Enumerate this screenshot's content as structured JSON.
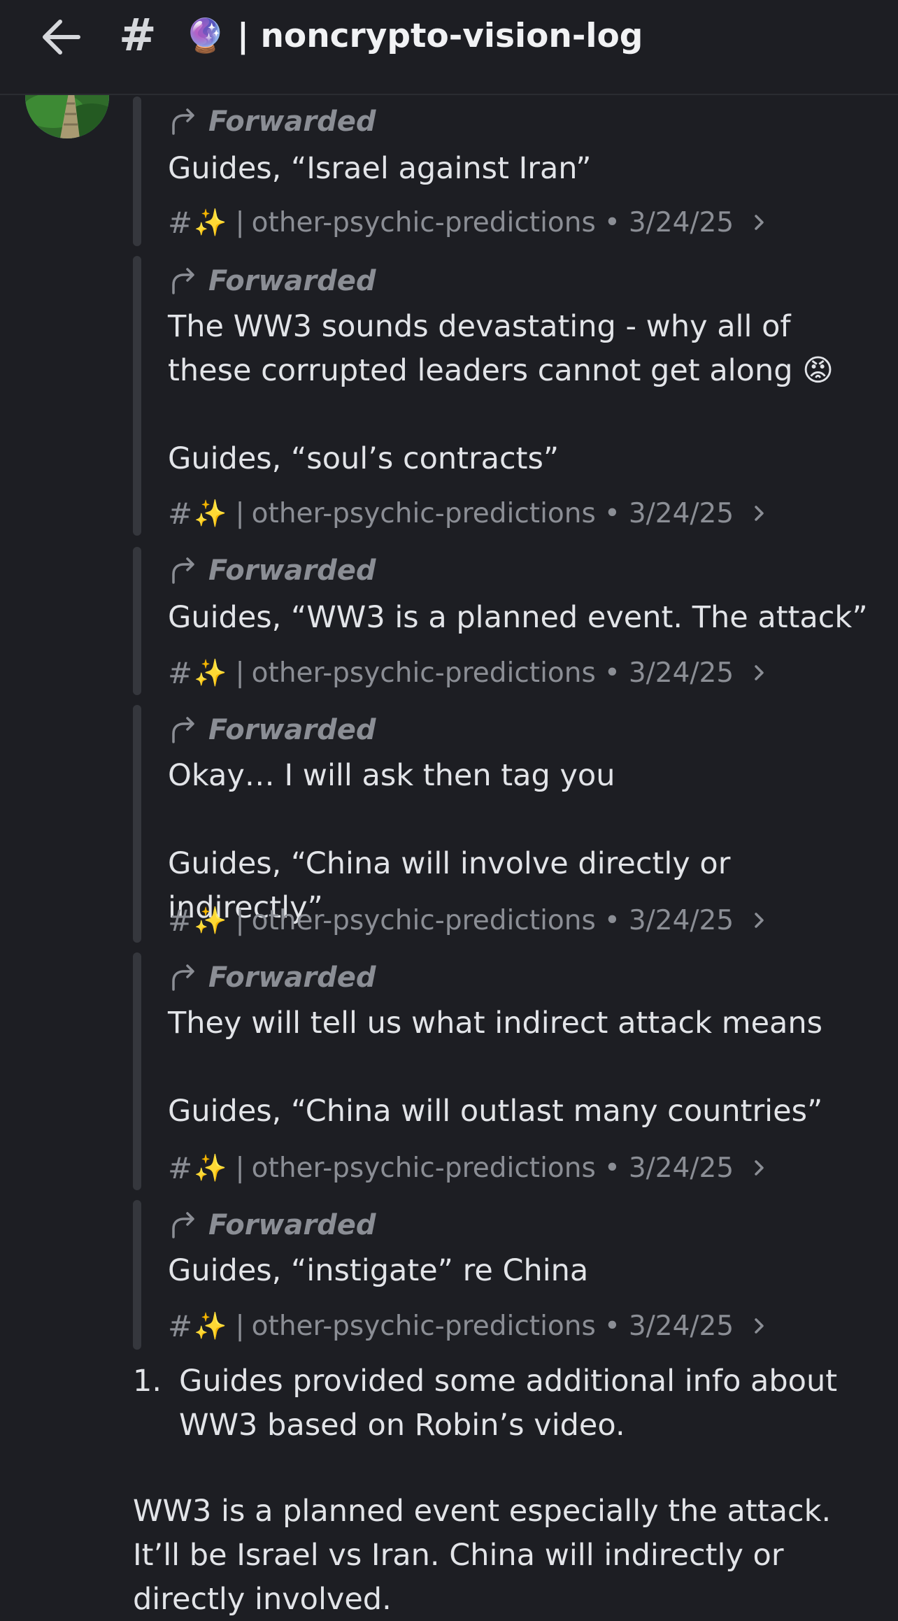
{
  "header": {
    "hash": "#",
    "title_emoji": "🔮",
    "title_sep": "|",
    "title_name": "noncrypto-vision-log"
  },
  "forwards": [
    {
      "label": "Forwarded",
      "text": "Guides, “Israel against Iran”",
      "source": {
        "hash": "#",
        "emoji": "✨",
        "sep": "|",
        "channel": "other-psychic-predictions",
        "dot": "•",
        "date": "3/24/25"
      }
    },
    {
      "label": "Forwarded",
      "text": "The WW3 sounds devastating - why all of these corrupted leaders cannot get along 😡\n\nGuides, “soul’s contracts”",
      "source": {
        "hash": "#",
        "emoji": "✨",
        "sep": "|",
        "channel": "other-psychic-predictions",
        "dot": "•",
        "date": "3/24/25"
      }
    },
    {
      "label": "Forwarded",
      "text": "Guides, “WW3 is a planned event. The attack”",
      "source": {
        "hash": "#",
        "emoji": "✨",
        "sep": "|",
        "channel": "other-psychic-predictions",
        "dot": "•",
        "date": "3/24/25"
      }
    },
    {
      "label": "Forwarded",
      "text": "Okay… I will ask then tag you\n\nGuides, “China will involve directly or indirectly”",
      "source": {
        "hash": "#",
        "emoji": "✨",
        "sep": "|",
        "channel": "other-psychic-predictions",
        "dot": "•",
        "date": "3/24/25"
      }
    },
    {
      "label": "Forwarded",
      "text": "They will tell us what indirect attack means\n\nGuides, “China will outlast many countries”",
      "source": {
        "hash": "#",
        "emoji": "✨",
        "sep": "|",
        "channel": "other-psychic-predictions",
        "dot": "•",
        "date": "3/24/25"
      }
    },
    {
      "label": "Forwarded",
      "text": "Guides, “instigate” re China",
      "source": {
        "hash": "#",
        "emoji": "✨",
        "sep": "|",
        "channel": "other-psychic-predictions",
        "dot": "•",
        "date": "3/24/25"
      }
    }
  ],
  "list": {
    "number": "1.",
    "text": "Guides provided some additional info about WW3 based on Robin’s video."
  },
  "paragraph": "WW3 is a planned event especially the attack. It’ll be Israel vs Iran. China will indirectly or directly involved.",
  "colors": {
    "background": "#1d1e23",
    "bar": "#35373d",
    "muted": "#8b8e95",
    "text": "#e2e4e8"
  },
  "icons": {
    "back": "arrow-left-icon",
    "forward": "forward-arrow-icon",
    "chevron": "chevron-right-icon"
  }
}
